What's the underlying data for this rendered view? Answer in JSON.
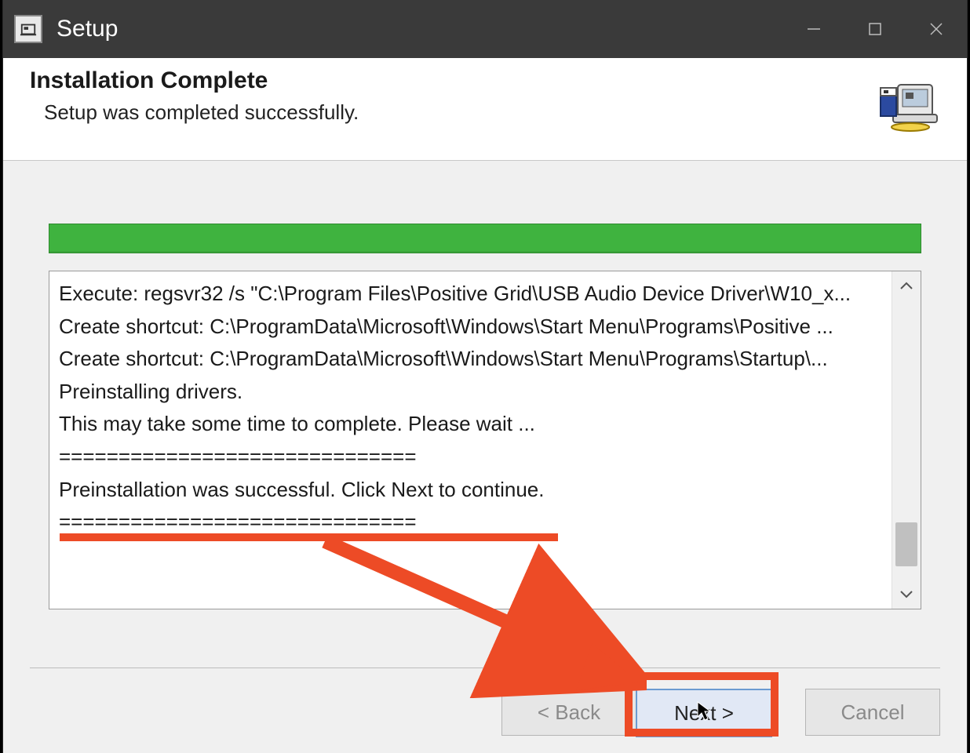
{
  "window": {
    "title": "Setup"
  },
  "header": {
    "title": "Installation Complete",
    "subtitle": "Setup was completed successfully."
  },
  "log": {
    "lines": [
      "Execute: regsvr32 /s \"C:\\Program Files\\Positive Grid\\USB Audio Device Driver\\W10_x...",
      "Create shortcut: C:\\ProgramData\\Microsoft\\Windows\\Start Menu\\Programs\\Positive ...",
      "Create shortcut: C:\\ProgramData\\Microsoft\\Windows\\Start Menu\\Programs\\Startup\\...",
      "Preinstalling drivers.",
      "This may take some time to complete. Please wait ...",
      "",
      "==============================",
      "Preinstallation was successful. Click Next to continue.",
      "=============================="
    ]
  },
  "footer": {
    "back": "< Back",
    "next": "Next >",
    "cancel": "Cancel"
  },
  "progress": {
    "percent": 100
  },
  "annotation": {
    "color": "#ed4b26"
  }
}
